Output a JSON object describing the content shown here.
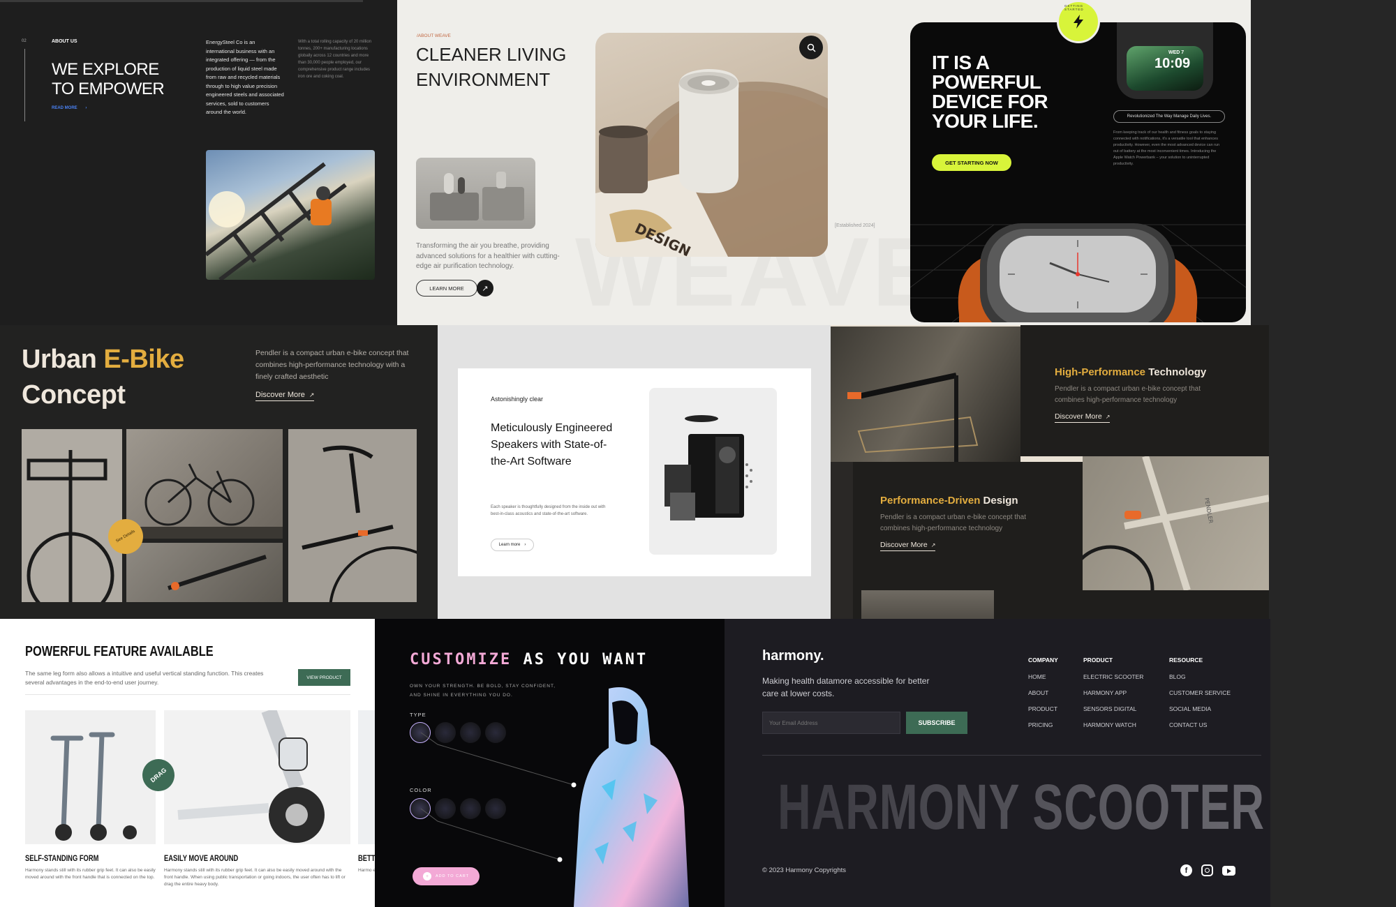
{
  "energysteel": {
    "section_num": "02",
    "section_label": "ABOUT US",
    "title_line1": "WE EXPLORE",
    "title_line2": "TO EMPOWER",
    "read_more": "READ MORE",
    "description": "EnergySteel Co is an international business with an integrated offering — from the production of liquid steel made from raw and recycled materials through to high value precision engineered steels and associated services, sold to customers around the world.",
    "stats_text": "With a total rolling capacity of 20 million tonnes, 200+ manufacturing locations globally across 12 countries and more than 30,000 people employed, our comprehensive product range includes iron ore and coking coal."
  },
  "weave": {
    "eyebrow": "/ABOUT WEAVE",
    "title_line1": "CLEANER LIVING",
    "title_line2": "ENVIRONMENT",
    "description": "Transforming the air you breathe, providing advanced solutions for a healthier with cutting-edge air purification technology.",
    "learn_more": "LEARN MORE",
    "established": "[Established 2024]",
    "watermark": "WEAVE",
    "book_text": "DESIGN"
  },
  "watch": {
    "title_line1": "IT IS A",
    "title_line2": "POWERFUL",
    "title_line3": "DEVICE FOR",
    "title_line4": "YOUR LIFE.",
    "cta": "GET STARTING NOW",
    "badge_text": "GETTING STARTED",
    "pill": "Revolutionized The Way Manage Daily Lives.",
    "body": "From keeping track of our health and fitness goals to staying connected with notifications, it's a versatile tool that enhances productivity. However, even the most advanced device can run out of battery at the most inconvenient times. Introducing the Apple Watch Powerbank – your solution to uninterrupted productivity.",
    "screen_date": "WED 7",
    "screen_time": "10:09"
  },
  "ebike": {
    "title_part1": "Urban ",
    "title_accent": "E-Bike",
    "title_line2": "Concept",
    "description": "Pendler is a compact urban e-bike concept that combines high-performance technology with a finely crafted aesthetic",
    "discover": "Discover More",
    "badge": "See Details",
    "accent_color": "#e3ad3f"
  },
  "speakers": {
    "eyebrow": "Astonishingly clear",
    "title": "Meticulously Engineered Speakers with State-of-the-Art Software",
    "description": "Each speaker is thoughtfully designed from the inside out with best-in-class acoustics and state-of-the-art software.",
    "cta": "Learn more"
  },
  "pendler": {
    "card1_accent": "High-Performance",
    "card1_rest": " Technology",
    "card1_desc": "Pendler is a compact urban e-bike concept that combines high-performance technology",
    "card1_link": "Discover More",
    "card2_accent": "Performance-Driven",
    "card2_rest": " Design",
    "card2_desc": "Pendler is a compact urban e-bike concept that combines high-performance technology",
    "card2_link": "Discover More",
    "bike_label": "PENDLER"
  },
  "scooter_feature": {
    "title": "POWERFUL FEATURE AVAILABLE",
    "subtitle": "The same leg form also allows a intuitive and useful vertical standing function. This creates several advantages in the end-to-end user journey.",
    "cta": "VIEW PRODUCT",
    "drag": "DRAG",
    "items": [
      {
        "title": "SELF-STANDING FORM",
        "desc": "Harmony stands still with its rubber grip feet. It can also be easily moved around with the front handle that is connected on the top."
      },
      {
        "title": "EASILY MOVE AROUND",
        "desc": "Harmony stands still with its rubber grip feet. It can also be easily moved around with the front handle. When using public transportation or going indoors, the user often has to lift or drag the entire heavy body."
      },
      {
        "title": "BETTE",
        "desc": "Harmo easily front"
      }
    ]
  },
  "customize": {
    "title_accent": "CUSTOMIZE",
    "title_rest": " AS YOU WANT",
    "tagline": "OWN YOUR STRENGTH. BE BOLD, STAY CONFIDENT, AND SHINE IN EVERYTHING YOU DO.",
    "type_label": "TYPE",
    "color_label": "COLOR",
    "cta": "ADD TO CART"
  },
  "harmony": {
    "logo": "harmony.",
    "tagline": "Making health datamore accessible for better care at lower costs.",
    "email_placeholder": "Your Email Address",
    "subscribe": "SUBSCRIBE",
    "columns": [
      {
        "heading": "COMPANY",
        "links": [
          "HOME",
          "ABOUT",
          "PRODUCT",
          "PRICING"
        ]
      },
      {
        "heading": "PRODUCT",
        "links": [
          "ELECTRIC SCOOTER",
          "HARMONY APP",
          "SENSORS DIGITAL",
          "HARMONY WATCH"
        ]
      },
      {
        "heading": "RESOURCE",
        "links": [
          "BLOG",
          "CUSTOMER SERVICE",
          "SOCIAL MEDIA",
          "CONTACT US"
        ]
      }
    ],
    "big_title": "HARMONY SCOOTER",
    "copyright": "2023  Harmony Copyrights"
  },
  "colors": {
    "lime": "#d8f43a",
    "pink": "#f3a9d6",
    "green": "#3d6b55",
    "gold": "#e3ad3f",
    "orange": "#e86a2a"
  }
}
